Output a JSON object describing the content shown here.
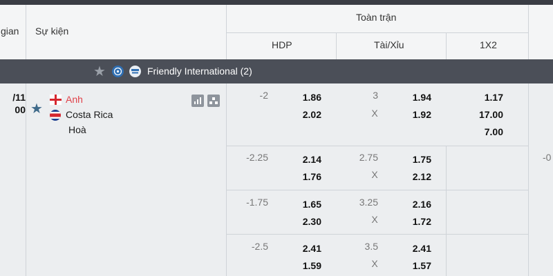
{
  "header": {
    "time_label": "gian",
    "event_label": "Sự kiện",
    "fulltime_label": "Toàn trận",
    "hdp_label": "HDP",
    "ou_label": "Tài/Xỉu",
    "x12_label": "1X2"
  },
  "league": {
    "name": "Friendly International (2)",
    "colors": {
      "bar": "#4b4f58",
      "star": "#9aa0a8"
    }
  },
  "match": {
    "date": "/11",
    "time": "00",
    "home": "Anh",
    "away": "Costa Rica",
    "draw": "Hoà",
    "icons": [
      "stats-icon",
      "lineup-icon"
    ]
  },
  "odds_rows": [
    {
      "hdp_line": "-2",
      "hdp_home": "1.86",
      "hdp_away": "2.02",
      "ou_line": "3",
      "ou_x": "X",
      "ou_over": "1.94",
      "ou_under": "1.92",
      "x12_home": "1.17",
      "x12_away": "17.00",
      "x12_draw": "7.00"
    },
    {
      "hdp_line": "-2.25",
      "hdp_home": "2.14",
      "hdp_away": "1.76",
      "ou_line": "2.75",
      "ou_x": "X",
      "ou_over": "1.75",
      "ou_under": "2.12"
    },
    {
      "hdp_line": "-1.75",
      "hdp_home": "1.65",
      "hdp_away": "2.30",
      "ou_line": "3.25",
      "ou_x": "X",
      "ou_over": "2.16",
      "ou_under": "1.72"
    },
    {
      "hdp_line": "-2.5",
      "hdp_home": "2.41",
      "hdp_away": "1.59",
      "ou_line": "3.5",
      "ou_x": "X",
      "ou_over": "2.41",
      "ou_under": "1.57"
    }
  ],
  "right_partial": "-0"
}
